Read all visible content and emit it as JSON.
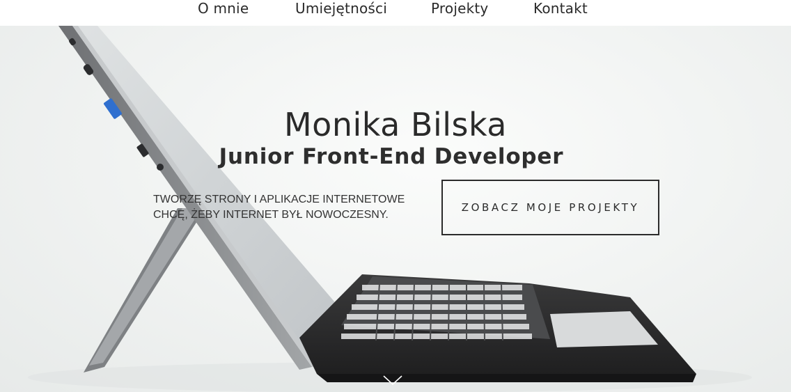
{
  "nav": {
    "items": [
      {
        "label": "O mnie"
      },
      {
        "label": "Umiejętności"
      },
      {
        "label": "Projekty"
      },
      {
        "label": "Kontakt"
      }
    ]
  },
  "hero": {
    "name": "Monika Bilska",
    "role": "Junior Front-End Developer",
    "tagline": {
      "line1": "Tworzę strony i aplikacje internetowe",
      "line2": "Chcę, żeby internet był nowoczesny."
    },
    "cta_label": "ZOBACZ MOJE PROJEKTY",
    "scroll_icon": "chevron-down-icon",
    "background_image": "laptop-photo"
  },
  "colors": {
    "text": "#2b2b2b",
    "background": "#f2f4f3",
    "keyboard": "#2c2c2c",
    "tablet_frame": "#8d8f91"
  }
}
